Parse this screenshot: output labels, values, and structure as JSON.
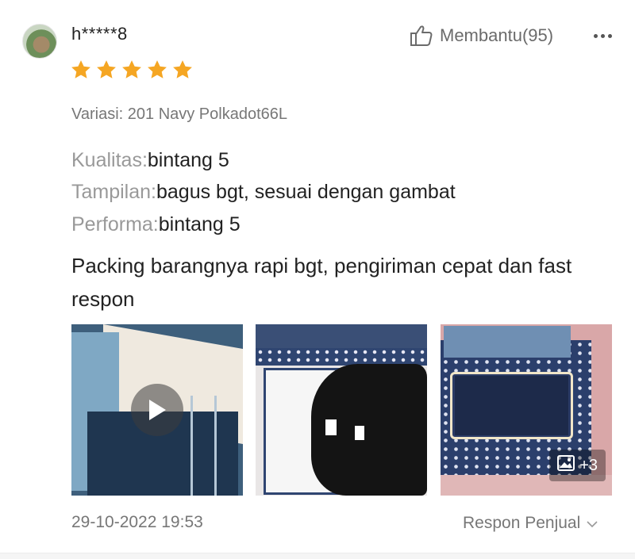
{
  "review": {
    "username": "h*****8",
    "helpful_label": "Membantu(95)",
    "rating": 5,
    "variation": "Variasi: 201 Navy Polkadot66L",
    "attributes": [
      {
        "key": "Kualitas:",
        "value": "bintang 5"
      },
      {
        "key": "Tampilan:",
        "value": "bagus bgt, sesuai dengan gambat"
      },
      {
        "key": "Performa:",
        "value": "bintang 5"
      }
    ],
    "comment": "Packing barangnya rapi bgt, pengiriman cepat dan fast respon",
    "media_more_count": "+3",
    "date": "29-10-2022 19:53",
    "seller_response_label": "Respon Penjual"
  },
  "colors": {
    "star": "#f5a623",
    "text": "#222222",
    "muted": "#777777",
    "key_muted": "#999999"
  },
  "icons": {
    "helpful": "thumbs-up-icon",
    "more": "more-dots-icon",
    "play": "play-icon",
    "gallery": "image-icon",
    "chevron": "chevron-down-icon"
  }
}
